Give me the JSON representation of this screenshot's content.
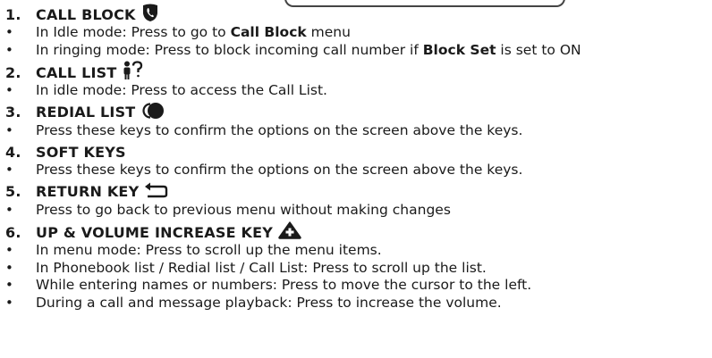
{
  "sections": [
    {
      "number": "1.",
      "title": "CALL BLOCK",
      "icon": "shield-phone-icon",
      "bullets": [
        {
          "parts": [
            {
              "t": "In Idle mode: Press to go to ",
              "b": false
            },
            {
              "t": "Call Block",
              "b": true
            },
            {
              "t": " menu",
              "b": false
            }
          ]
        },
        {
          "parts": [
            {
              "t": "In ringing mode: Press to block incoming call number if ",
              "b": false
            },
            {
              "t": "Block Set",
              "b": true
            },
            {
              "t": " is set to ON",
              "b": false
            }
          ]
        }
      ]
    },
    {
      "number": "2.",
      "title": "CALL LIST",
      "icon": "person-question-icon",
      "bullets": [
        {
          "parts": [
            {
              "t": "In idle mode: Press to access the Call List.",
              "b": false
            }
          ]
        }
      ]
    },
    {
      "number": "3.",
      "title": "REDIAL LIST",
      "icon": "redial-icon",
      "bullets": [
        {
          "parts": [
            {
              "t": "Press these keys to confirm the options on the screen above the keys.",
              "b": false
            }
          ]
        }
      ]
    },
    {
      "number": "4.",
      "title": "SOFT KEYS",
      "icon": "",
      "bullets": [
        {
          "parts": [
            {
              "t": "Press these keys to confirm the options on the screen above the keys.",
              "b": false
            }
          ]
        }
      ]
    },
    {
      "number": "5.",
      "title": "RETURN KEY",
      "icon": "return-arrow-icon",
      "bullets": [
        {
          "parts": [
            {
              "t": "Press to go back to previous menu without making changes",
              "b": false
            }
          ]
        }
      ]
    },
    {
      "number": "6.",
      "title": "UP & VOLUME INCREASE KEY",
      "icon": "up-volume-icon",
      "bullets": [
        {
          "parts": [
            {
              "t": "In menu mode: Press to scroll up the menu items.",
              "b": false
            }
          ]
        },
        {
          "parts": [
            {
              "t": "In Phonebook list / Redial list / Call List: Press to scroll up the list.",
              "b": false
            }
          ]
        },
        {
          "parts": [
            {
              "t": "While entering names or numbers: Press to move the cursor to the left.",
              "b": false
            }
          ]
        },
        {
          "parts": [
            {
              "t": "During a call and message playback: Press to increase the volume.",
              "b": false
            }
          ]
        }
      ]
    }
  ]
}
